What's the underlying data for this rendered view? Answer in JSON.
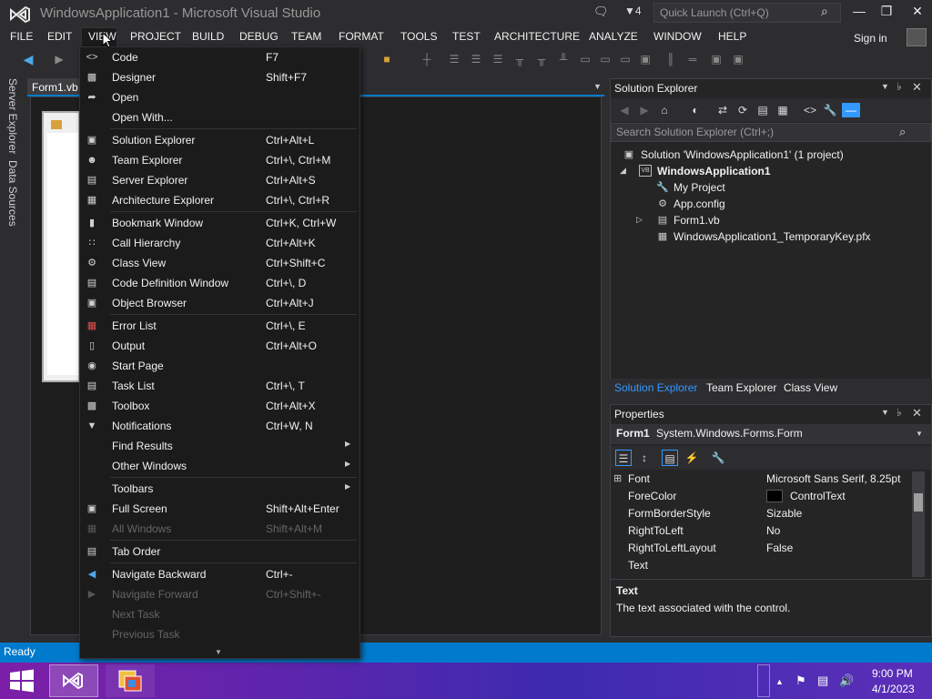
{
  "window": {
    "title": "WindowsApplication1 - Microsoft Visual Studio",
    "notification_count": "4",
    "quick_launch_placeholder": "Quick Launch (Ctrl+Q)",
    "sign_in": "Sign in"
  },
  "menubar": {
    "items": [
      "FILE",
      "EDIT",
      "VIEW",
      "PROJECT",
      "BUILD",
      "DEBUG",
      "TEAM",
      "FORMAT",
      "TOOLS",
      "TEST",
      "ARCHITECTURE",
      "ANALYZE",
      "WINDOW",
      "HELP"
    ],
    "open_menu": "VIEW"
  },
  "left_tabs": [
    "Server Explorer",
    "Data Sources"
  ],
  "document": {
    "tab": "Form1.vb"
  },
  "view_menu": {
    "items": [
      {
        "label": "Code",
        "shortcut": "F7",
        "icon": "code-icon",
        "enabled": true
      },
      {
        "label": "Designer",
        "shortcut": "Shift+F7",
        "icon": "designer-icon",
        "enabled": true
      },
      {
        "label": "Open",
        "shortcut": "",
        "icon": "open-icon",
        "enabled": true
      },
      {
        "label": "Open With...",
        "shortcut": "",
        "icon": "",
        "enabled": true
      },
      {
        "label": "Solution Explorer",
        "shortcut": "Ctrl+Alt+L",
        "icon": "solution-explorer-icon",
        "enabled": true
      },
      {
        "label": "Team Explorer",
        "shortcut": "Ctrl+\\, Ctrl+M",
        "icon": "team-explorer-icon",
        "enabled": true
      },
      {
        "label": "Server Explorer",
        "shortcut": "Ctrl+Alt+S",
        "icon": "server-explorer-icon",
        "enabled": true
      },
      {
        "label": "Architecture Explorer",
        "shortcut": "Ctrl+\\, Ctrl+R",
        "icon": "architecture-explorer-icon",
        "enabled": true
      },
      {
        "label": "Bookmark Window",
        "shortcut": "Ctrl+K, Ctrl+W",
        "icon": "bookmark-icon",
        "enabled": true
      },
      {
        "label": "Call Hierarchy",
        "shortcut": "Ctrl+Alt+K",
        "icon": "call-hierarchy-icon",
        "enabled": true
      },
      {
        "label": "Class View",
        "shortcut": "Ctrl+Shift+C",
        "icon": "class-view-icon",
        "enabled": true
      },
      {
        "label": "Code Definition Window",
        "shortcut": "Ctrl+\\, D",
        "icon": "code-definition-icon",
        "enabled": true
      },
      {
        "label": "Object Browser",
        "shortcut": "Ctrl+Alt+J",
        "icon": "object-browser-icon",
        "enabled": true
      },
      {
        "label": "Error List",
        "shortcut": "Ctrl+\\, E",
        "icon": "error-list-icon",
        "enabled": true
      },
      {
        "label": "Output",
        "shortcut": "Ctrl+Alt+O",
        "icon": "output-icon",
        "enabled": true
      },
      {
        "label": "Start Page",
        "shortcut": "",
        "icon": "start-page-icon",
        "enabled": true
      },
      {
        "label": "Task List",
        "shortcut": "Ctrl+\\, T",
        "icon": "task-list-icon",
        "enabled": true
      },
      {
        "label": "Toolbox",
        "shortcut": "Ctrl+Alt+X",
        "icon": "toolbox-icon",
        "enabled": true
      },
      {
        "label": "Notifications",
        "shortcut": "Ctrl+W, N",
        "icon": "notifications-icon",
        "enabled": true
      },
      {
        "label": "Find Results",
        "shortcut": "",
        "icon": "",
        "enabled": true,
        "submenu": true
      },
      {
        "label": "Other Windows",
        "shortcut": "",
        "icon": "",
        "enabled": true,
        "submenu": true
      },
      {
        "label": "Toolbars",
        "shortcut": "",
        "icon": "",
        "enabled": true,
        "submenu": true
      },
      {
        "label": "Full Screen",
        "shortcut": "Shift+Alt+Enter",
        "icon": "full-screen-icon",
        "enabled": true
      },
      {
        "label": "All Windows",
        "shortcut": "Shift+Alt+M",
        "icon": "all-windows-icon",
        "enabled": false
      },
      {
        "label": "Tab Order",
        "shortcut": "",
        "icon": "tab-order-icon",
        "enabled": true
      },
      {
        "label": "Navigate Backward",
        "shortcut": "Ctrl+-",
        "icon": "navigate-backward-icon",
        "enabled": true
      },
      {
        "label": "Navigate Forward",
        "shortcut": "Ctrl+Shift+-",
        "icon": "navigate-forward-icon",
        "enabled": false
      },
      {
        "label": "Next Task",
        "shortcut": "",
        "icon": "",
        "enabled": false
      },
      {
        "label": "Previous Task",
        "shortcut": "",
        "icon": "",
        "enabled": false
      }
    ]
  },
  "solution_explorer": {
    "title": "Solution Explorer",
    "search_placeholder": "Search Solution Explorer (Ctrl+;)",
    "tree": [
      {
        "label": "Solution 'WindowsApplication1' (1 project)",
        "level": 0,
        "icon": "solution-icon",
        "bold": false
      },
      {
        "label": "WindowsApplication1",
        "level": 1,
        "icon": "vb-project-icon",
        "bold": true
      },
      {
        "label": "My Project",
        "level": 2,
        "icon": "wrench-icon",
        "bold": false
      },
      {
        "label": "App.config",
        "level": 2,
        "icon": "config-icon",
        "bold": false
      },
      {
        "label": "Form1.vb",
        "level": 2,
        "icon": "form-icon",
        "bold": false
      },
      {
        "label": "WindowsApplication1_TemporaryKey.pfx",
        "level": 2,
        "icon": "certificate-icon",
        "bold": false
      }
    ],
    "tabs": [
      "Solution Explorer",
      "Team Explorer",
      "Class View"
    ]
  },
  "properties": {
    "title": "Properties",
    "object_name": "Form1",
    "object_type": "System.Windows.Forms.Form",
    "rows": [
      {
        "name": "Font",
        "value": "Microsoft Sans Serif, 8.25pt",
        "expandable": true
      },
      {
        "name": "ForeColor",
        "value": "ControlText",
        "swatch": "#000000"
      },
      {
        "name": "FormBorderStyle",
        "value": "Sizable"
      },
      {
        "name": "RightToLeft",
        "value": "No"
      },
      {
        "name": "RightToLeftLayout",
        "value": "False"
      },
      {
        "name": "Text",
        "value": ""
      }
    ],
    "description_title": "Text",
    "description_text": "The text associated with the control."
  },
  "status": {
    "text": "Ready"
  },
  "taskbar": {
    "time": "9:00 PM",
    "date": "4/1/2023"
  },
  "colors": {
    "accent": "#007acc",
    "background": "#2d2d30",
    "menu_bg": "#1b1b1c",
    "vs_purple": "#68217a"
  }
}
